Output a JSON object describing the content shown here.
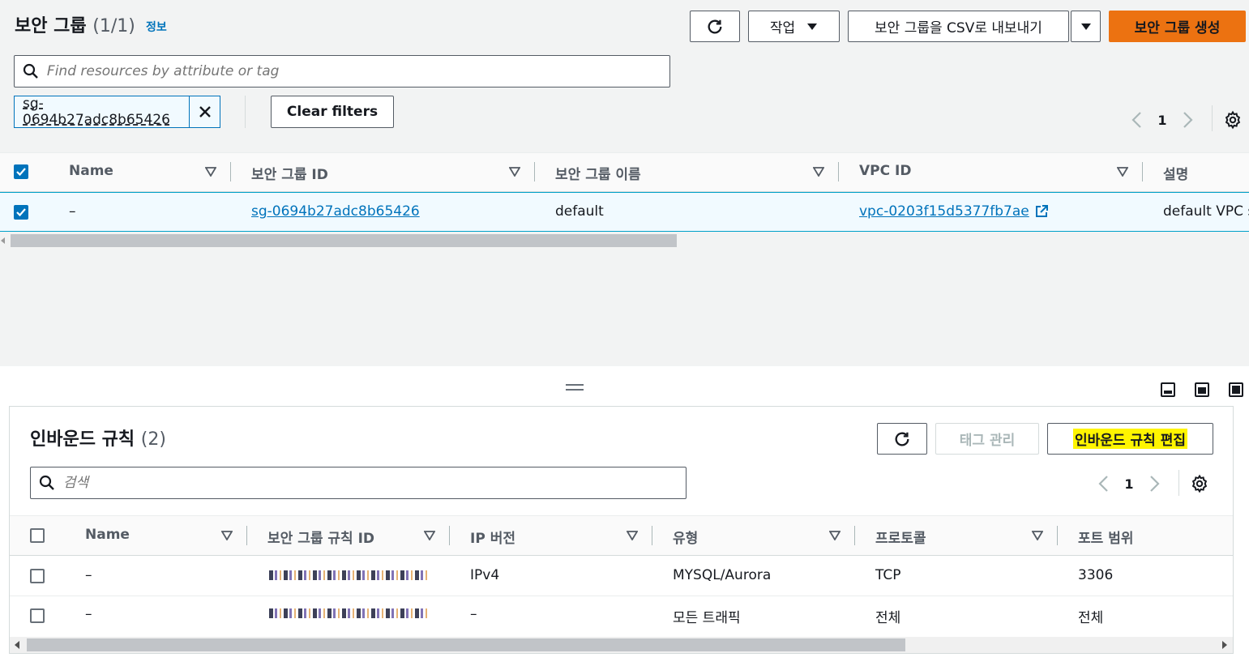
{
  "header": {
    "title": "보안 그룹",
    "count": "(1/1)",
    "info_link": "정보",
    "actions_label": "작업",
    "export_label": "보안 그룹을 CSV로 내보내기",
    "create_label": "보안 그룹 생성"
  },
  "search": {
    "placeholder": "Find resources by attribute or tag"
  },
  "filter": {
    "token": "sg-0694b27adc8b65426",
    "clear_label": "Clear filters"
  },
  "pagination": {
    "current_page": "1"
  },
  "sg_table": {
    "columns": [
      "Name",
      "보안 그룹 ID",
      "보안 그룹 이름",
      "VPC ID",
      "설명"
    ],
    "rows": [
      {
        "name": "–",
        "group_id": "sg-0694b27adc8b65426",
        "group_name": "default",
        "vpc_id": "vpc-0203f15d5377fb7ae",
        "description": "default VPC s"
      }
    ]
  },
  "inbound": {
    "title": "인바운드 규칙",
    "count": "(2)",
    "manage_tags_label": "태그 관리",
    "edit_label": "인바운드 규칙 편집",
    "search_placeholder": "검색",
    "page": "1",
    "columns": [
      "Name",
      "보안 그룹 규칙 ID",
      "IP 버전",
      "유형",
      "프로토콜",
      "포트 범위"
    ],
    "rows": [
      {
        "name": "–",
        "ip_version": "IPv4",
        "type": "MYSQL/Aurora",
        "protocol": "TCP",
        "port_range": "3306"
      },
      {
        "name": "–",
        "ip_version": "–",
        "type": "모든 트래픽",
        "protocol": "전체",
        "port_range": "전체"
      }
    ]
  },
  "colors": {
    "accent": "#0073bb",
    "primary_button": "#ec7211",
    "highlight": "#fff500",
    "panel_bg": "#f2f3f3"
  },
  "icons": [
    "refresh-icon",
    "caret-down-icon",
    "search-icon",
    "close-icon",
    "chevron-left-icon",
    "chevron-right-icon",
    "settings-icon",
    "external-link-icon",
    "sort-icon",
    "checkbox-icon",
    "layout-icon"
  ]
}
